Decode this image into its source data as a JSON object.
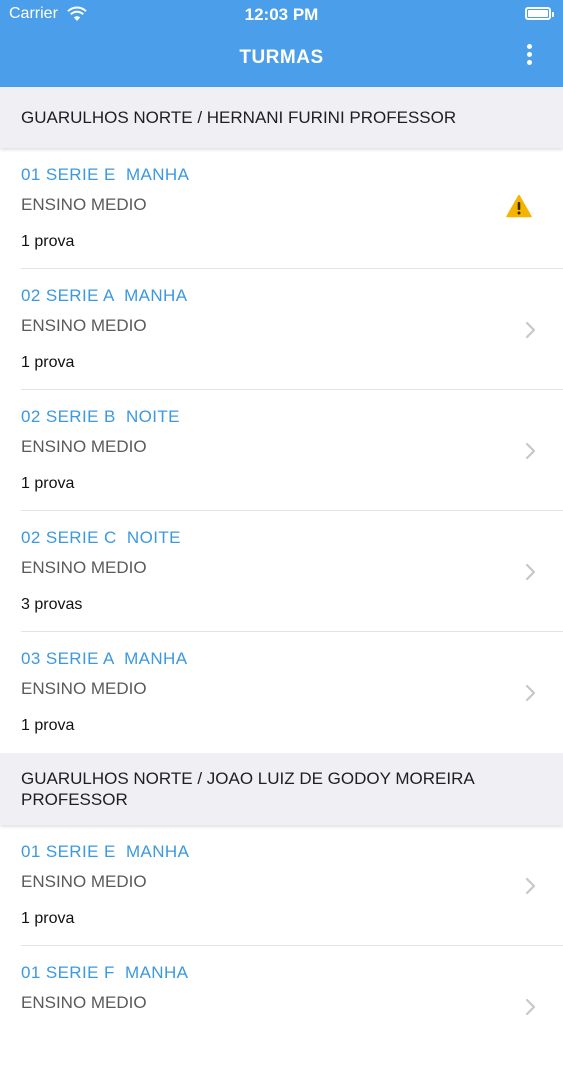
{
  "status": {
    "carrier": "Carrier",
    "time": "12:03 PM"
  },
  "nav": {
    "title": "TURMAS"
  },
  "sections": [
    {
      "header": "GUARULHOS NORTE / HERNANI FURINI PROFESSOR",
      "rows": [
        {
          "title": "01 SERIE E  MANHA",
          "subtitle": "ENSINO MEDIO",
          "count": "1 prova",
          "icon": "warning-icon"
        },
        {
          "title": "02 SERIE A  MANHA",
          "subtitle": "ENSINO MEDIO",
          "count": "1 prova",
          "icon": "chevron-right-icon"
        },
        {
          "title": "02 SERIE B  NOITE",
          "subtitle": "ENSINO MEDIO",
          "count": "1 prova",
          "icon": "chevron-right-icon"
        },
        {
          "title": "02 SERIE C  NOITE",
          "subtitle": "ENSINO MEDIO",
          "count": "3 provas",
          "icon": "chevron-right-icon"
        },
        {
          "title": "03 SERIE A  MANHA",
          "subtitle": "ENSINO MEDIO",
          "count": "1 prova",
          "icon": "chevron-right-icon"
        }
      ]
    },
    {
      "header": "GUARULHOS NORTE / JOAO LUIZ DE GODOY MOREIRA PROFESSOR",
      "rows": [
        {
          "title": "01 SERIE E  MANHA",
          "subtitle": "ENSINO MEDIO",
          "count": "1 prova",
          "icon": "chevron-right-icon"
        },
        {
          "title": "01 SERIE F  MANHA",
          "subtitle": "ENSINO MEDIO",
          "count": "",
          "icon": "chevron-right-icon"
        }
      ]
    }
  ],
  "colors": {
    "nav": "#4a9eea",
    "accent": "#3b99e0",
    "warning": "#f5b400"
  }
}
